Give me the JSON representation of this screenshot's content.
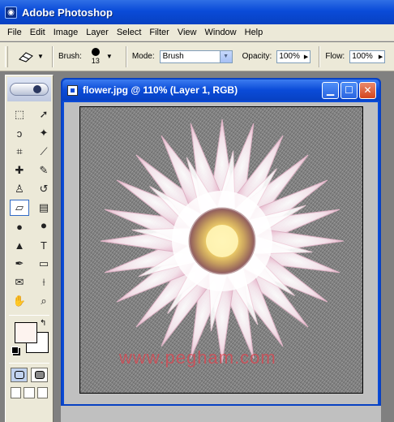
{
  "app": {
    "title": "Adobe Photoshop",
    "icon": "photoshop-app-icon"
  },
  "menu": [
    "File",
    "Edit",
    "Image",
    "Layer",
    "Select",
    "Filter",
    "View",
    "Window",
    "Help"
  ],
  "options": {
    "brush_label": "Brush:",
    "brush_size": "13",
    "mode_label": "Mode:",
    "mode_value": "Brush",
    "opacity_label": "Opacity:",
    "opacity_value": "100%",
    "flow_label": "Flow:",
    "flow_value": "100%"
  },
  "document": {
    "title": "flower.jpg @ 110% (Layer 1, RGB)",
    "watermark": "www.pegham.com"
  },
  "colors": {
    "foreground": "#fdf3ef",
    "background": "#ffffff",
    "accent": "#0a4bd8"
  }
}
